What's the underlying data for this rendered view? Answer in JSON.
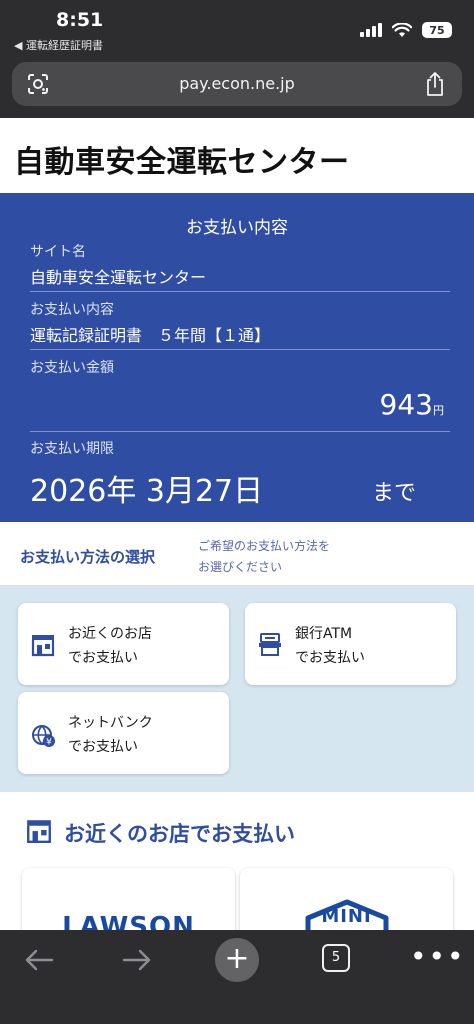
{
  "status_bar": {
    "time": "8:51",
    "back_app": "◀ 運転経歴証明書",
    "battery": "75"
  },
  "browser": {
    "url": "pay.econ.ne.jp",
    "tab_count": "5",
    "new_tab": "+",
    "more": "•••"
  },
  "page": {
    "title": "自動車安全運転センター"
  },
  "summary": {
    "heading": "お支払い内容",
    "site_label": "サイト名",
    "site_value": "自動車安全運転センター",
    "content_label": "お支払い内容",
    "content_value": "運転記録証明書　５年間【１通】",
    "amount_label": "お支払い金額",
    "amount_value": "943",
    "amount_unit": "円",
    "deadline_label": "お支払い期限",
    "deadline_value": "2026年 3月27日",
    "deadline_suffix": "まで"
  },
  "method": {
    "title": "お支払い方法の選択",
    "hint_line1": "ご希望のお支払い方法を",
    "hint_line2": "お選びください",
    "options": [
      {
        "label": "お近くのお店\nでお支払い",
        "icon": "store-icon"
      },
      {
        "label": "銀行ATM\nでお支払い",
        "icon": "atm-icon"
      },
      {
        "label": "ネットバンク\nでお支払い",
        "icon": "netbank-icon"
      }
    ]
  },
  "stores": {
    "title": "お近くのお店でお支払い",
    "items": [
      {
        "name": "LAWSON"
      },
      {
        "name": "MINI"
      }
    ]
  },
  "colors": {
    "brand_blue": "#2f4da2",
    "options_bg": "#d6e6f1",
    "browser_chrome": "#2d2d2f"
  }
}
